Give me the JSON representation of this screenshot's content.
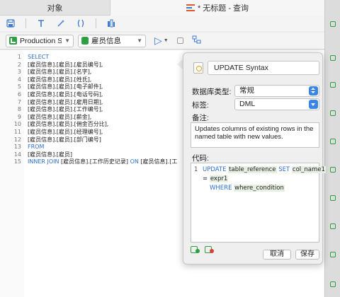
{
  "tabs": {
    "objects": "对象",
    "query": "* 无标题 - 查询"
  },
  "toolbar": {
    "icons": [
      "save-icon",
      "format-icon",
      "magic-wand-icon",
      "brackets-icon",
      "code-snippet-icon"
    ]
  },
  "connection": {
    "server": "Production Server",
    "database": "雇员信息"
  },
  "editor": {
    "lines": [
      {
        "n": "1",
        "parts": [
          {
            "t": "SELECT",
            "kw": true
          }
        ]
      },
      {
        "n": "2",
        "parts": [
          {
            "t": "[雇员信息].[雇员].[雇员编号],"
          }
        ]
      },
      {
        "n": "3",
        "parts": [
          {
            "t": "[雇员信息].[雇员].[名字],"
          }
        ]
      },
      {
        "n": "4",
        "parts": [
          {
            "t": "[雇员信息].[雇员].[姓氏],"
          }
        ]
      },
      {
        "n": "5",
        "parts": [
          {
            "t": "[雇员信息].[雇员].[电子邮件],"
          }
        ]
      },
      {
        "n": "6",
        "parts": [
          {
            "t": "[雇员信息].[雇员].[电话号码],"
          }
        ]
      },
      {
        "n": "7",
        "parts": [
          {
            "t": "[雇员信息].[雇员].[雇用日期],"
          }
        ]
      },
      {
        "n": "8",
        "parts": [
          {
            "t": "[雇员信息].[雇员].[工作编号],"
          }
        ]
      },
      {
        "n": "9",
        "parts": [
          {
            "t": "[雇员信息].[雇员].[薪金],"
          }
        ]
      },
      {
        "n": "10",
        "parts": [
          {
            "t": "[雇员信息].[雇员].[佣金百分比],"
          }
        ]
      },
      {
        "n": "11",
        "parts": [
          {
            "t": "[雇员信息].[雇员].[经理编号],"
          }
        ]
      },
      {
        "n": "12",
        "parts": [
          {
            "t": "[雇员信息].[雇员].[部门编号]"
          }
        ]
      },
      {
        "n": "13",
        "parts": [
          {
            "t": "FROM",
            "kw": true
          }
        ]
      },
      {
        "n": "14",
        "parts": [
          {
            "t": "[雇员信息].[雇员]"
          }
        ]
      },
      {
        "n": "15",
        "parts": [
          {
            "t": "INNER JOIN",
            "kw": true
          },
          {
            "t": " [雇员信息].[工作历史记录] "
          },
          {
            "t": "ON",
            "kw": true
          },
          {
            "t": " [雇员信息].[工"
          }
        ]
      }
    ]
  },
  "snippet": {
    "name": "UPDATE Syntax",
    "db_type_label": "数据库类型:",
    "db_type_value": "常规",
    "tag_label": "标签:",
    "tag_value": "DML",
    "desc_label": "备注:",
    "description": "Updates columns of existing rows in the named table with new values.",
    "code_label": "代码:",
    "code": {
      "line_no": "1",
      "kw_update": "UPDATE",
      "table_ref": "table_reference",
      "kw_set": "SET",
      "col": "col_name1",
      "eq": "=",
      "expr": "expr1",
      "kw_where": "WHERE",
      "cond": "where_condition"
    },
    "cancel": "取消",
    "save": "保存"
  }
}
